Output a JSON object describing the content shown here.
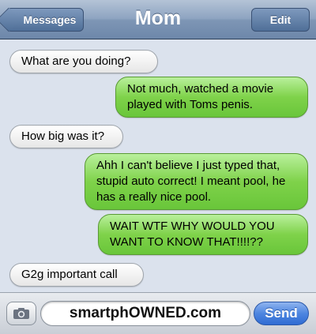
{
  "navbar": {
    "title": "Mom",
    "back_label": "Messages",
    "edit_label": "Edit"
  },
  "messages": [
    {
      "from": "received",
      "text": "What are you doing?"
    },
    {
      "from": "sent",
      "text": "Not much, watched a movie played with Toms penis."
    },
    {
      "from": "received",
      "text": "How big was it?"
    },
    {
      "from": "sent",
      "text": "Ahh I can't believe I just typed that, stupid auto correct! I meant pool, he has a really nice pool."
    },
    {
      "from": "sent",
      "text": "WAIT WTF WHY WOULD YOU WANT TO KNOW THAT!!!!??"
    },
    {
      "from": "received",
      "text": "G2g important call"
    }
  ],
  "composer": {
    "input_value": "smartphOWNED.com",
    "send_label": "Send",
    "camera_icon": "camera-icon"
  },
  "colors": {
    "sent_bubble": "#7fd24a",
    "received_bubble": "#ffffff",
    "background": "#dbe2ed",
    "send_button": "#4d86e0"
  }
}
